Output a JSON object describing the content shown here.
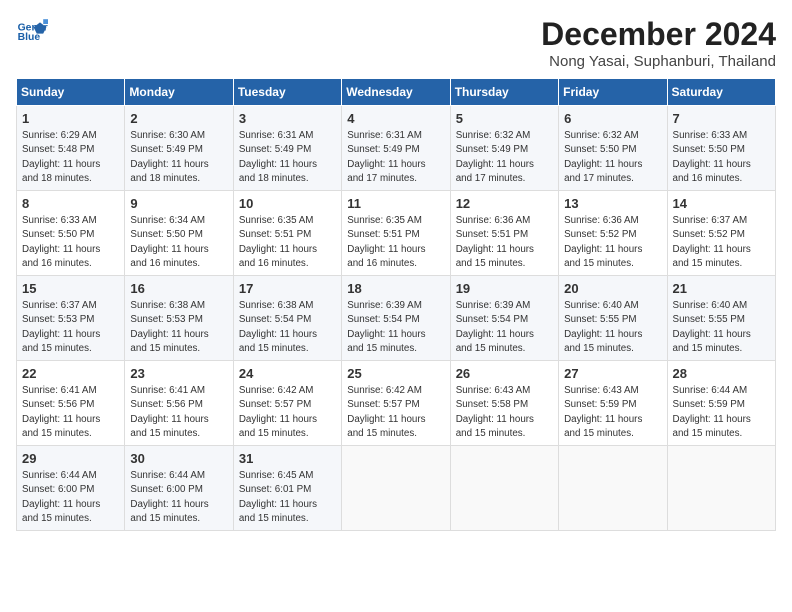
{
  "header": {
    "logo_line1": "General",
    "logo_line2": "Blue",
    "month_title": "December 2024",
    "subtitle": "Nong Yasai, Suphanburi, Thailand"
  },
  "days_of_week": [
    "Sunday",
    "Monday",
    "Tuesday",
    "Wednesday",
    "Thursday",
    "Friday",
    "Saturday"
  ],
  "weeks": [
    [
      {
        "day": "1",
        "info": "Sunrise: 6:29 AM\nSunset: 5:48 PM\nDaylight: 11 hours\nand 18 minutes."
      },
      {
        "day": "2",
        "info": "Sunrise: 6:30 AM\nSunset: 5:49 PM\nDaylight: 11 hours\nand 18 minutes."
      },
      {
        "day": "3",
        "info": "Sunrise: 6:31 AM\nSunset: 5:49 PM\nDaylight: 11 hours\nand 18 minutes."
      },
      {
        "day": "4",
        "info": "Sunrise: 6:31 AM\nSunset: 5:49 PM\nDaylight: 11 hours\nand 17 minutes."
      },
      {
        "day": "5",
        "info": "Sunrise: 6:32 AM\nSunset: 5:49 PM\nDaylight: 11 hours\nand 17 minutes."
      },
      {
        "day": "6",
        "info": "Sunrise: 6:32 AM\nSunset: 5:50 PM\nDaylight: 11 hours\nand 17 minutes."
      },
      {
        "day": "7",
        "info": "Sunrise: 6:33 AM\nSunset: 5:50 PM\nDaylight: 11 hours\nand 16 minutes."
      }
    ],
    [
      {
        "day": "8",
        "info": "Sunrise: 6:33 AM\nSunset: 5:50 PM\nDaylight: 11 hours\nand 16 minutes."
      },
      {
        "day": "9",
        "info": "Sunrise: 6:34 AM\nSunset: 5:50 PM\nDaylight: 11 hours\nand 16 minutes."
      },
      {
        "day": "10",
        "info": "Sunrise: 6:35 AM\nSunset: 5:51 PM\nDaylight: 11 hours\nand 16 minutes."
      },
      {
        "day": "11",
        "info": "Sunrise: 6:35 AM\nSunset: 5:51 PM\nDaylight: 11 hours\nand 16 minutes."
      },
      {
        "day": "12",
        "info": "Sunrise: 6:36 AM\nSunset: 5:51 PM\nDaylight: 11 hours\nand 15 minutes."
      },
      {
        "day": "13",
        "info": "Sunrise: 6:36 AM\nSunset: 5:52 PM\nDaylight: 11 hours\nand 15 minutes."
      },
      {
        "day": "14",
        "info": "Sunrise: 6:37 AM\nSunset: 5:52 PM\nDaylight: 11 hours\nand 15 minutes."
      }
    ],
    [
      {
        "day": "15",
        "info": "Sunrise: 6:37 AM\nSunset: 5:53 PM\nDaylight: 11 hours\nand 15 minutes."
      },
      {
        "day": "16",
        "info": "Sunrise: 6:38 AM\nSunset: 5:53 PM\nDaylight: 11 hours\nand 15 minutes."
      },
      {
        "day": "17",
        "info": "Sunrise: 6:38 AM\nSunset: 5:54 PM\nDaylight: 11 hours\nand 15 minutes."
      },
      {
        "day": "18",
        "info": "Sunrise: 6:39 AM\nSunset: 5:54 PM\nDaylight: 11 hours\nand 15 minutes."
      },
      {
        "day": "19",
        "info": "Sunrise: 6:39 AM\nSunset: 5:54 PM\nDaylight: 11 hours\nand 15 minutes."
      },
      {
        "day": "20",
        "info": "Sunrise: 6:40 AM\nSunset: 5:55 PM\nDaylight: 11 hours\nand 15 minutes."
      },
      {
        "day": "21",
        "info": "Sunrise: 6:40 AM\nSunset: 5:55 PM\nDaylight: 11 hours\nand 15 minutes."
      }
    ],
    [
      {
        "day": "22",
        "info": "Sunrise: 6:41 AM\nSunset: 5:56 PM\nDaylight: 11 hours\nand 15 minutes."
      },
      {
        "day": "23",
        "info": "Sunrise: 6:41 AM\nSunset: 5:56 PM\nDaylight: 11 hours\nand 15 minutes."
      },
      {
        "day": "24",
        "info": "Sunrise: 6:42 AM\nSunset: 5:57 PM\nDaylight: 11 hours\nand 15 minutes."
      },
      {
        "day": "25",
        "info": "Sunrise: 6:42 AM\nSunset: 5:57 PM\nDaylight: 11 hours\nand 15 minutes."
      },
      {
        "day": "26",
        "info": "Sunrise: 6:43 AM\nSunset: 5:58 PM\nDaylight: 11 hours\nand 15 minutes."
      },
      {
        "day": "27",
        "info": "Sunrise: 6:43 AM\nSunset: 5:59 PM\nDaylight: 11 hours\nand 15 minutes."
      },
      {
        "day": "28",
        "info": "Sunrise: 6:44 AM\nSunset: 5:59 PM\nDaylight: 11 hours\nand 15 minutes."
      }
    ],
    [
      {
        "day": "29",
        "info": "Sunrise: 6:44 AM\nSunset: 6:00 PM\nDaylight: 11 hours\nand 15 minutes."
      },
      {
        "day": "30",
        "info": "Sunrise: 6:44 AM\nSunset: 6:00 PM\nDaylight: 11 hours\nand 15 minutes."
      },
      {
        "day": "31",
        "info": "Sunrise: 6:45 AM\nSunset: 6:01 PM\nDaylight: 11 hours\nand 15 minutes."
      },
      {
        "day": "",
        "info": ""
      },
      {
        "day": "",
        "info": ""
      },
      {
        "day": "",
        "info": ""
      },
      {
        "day": "",
        "info": ""
      }
    ]
  ]
}
